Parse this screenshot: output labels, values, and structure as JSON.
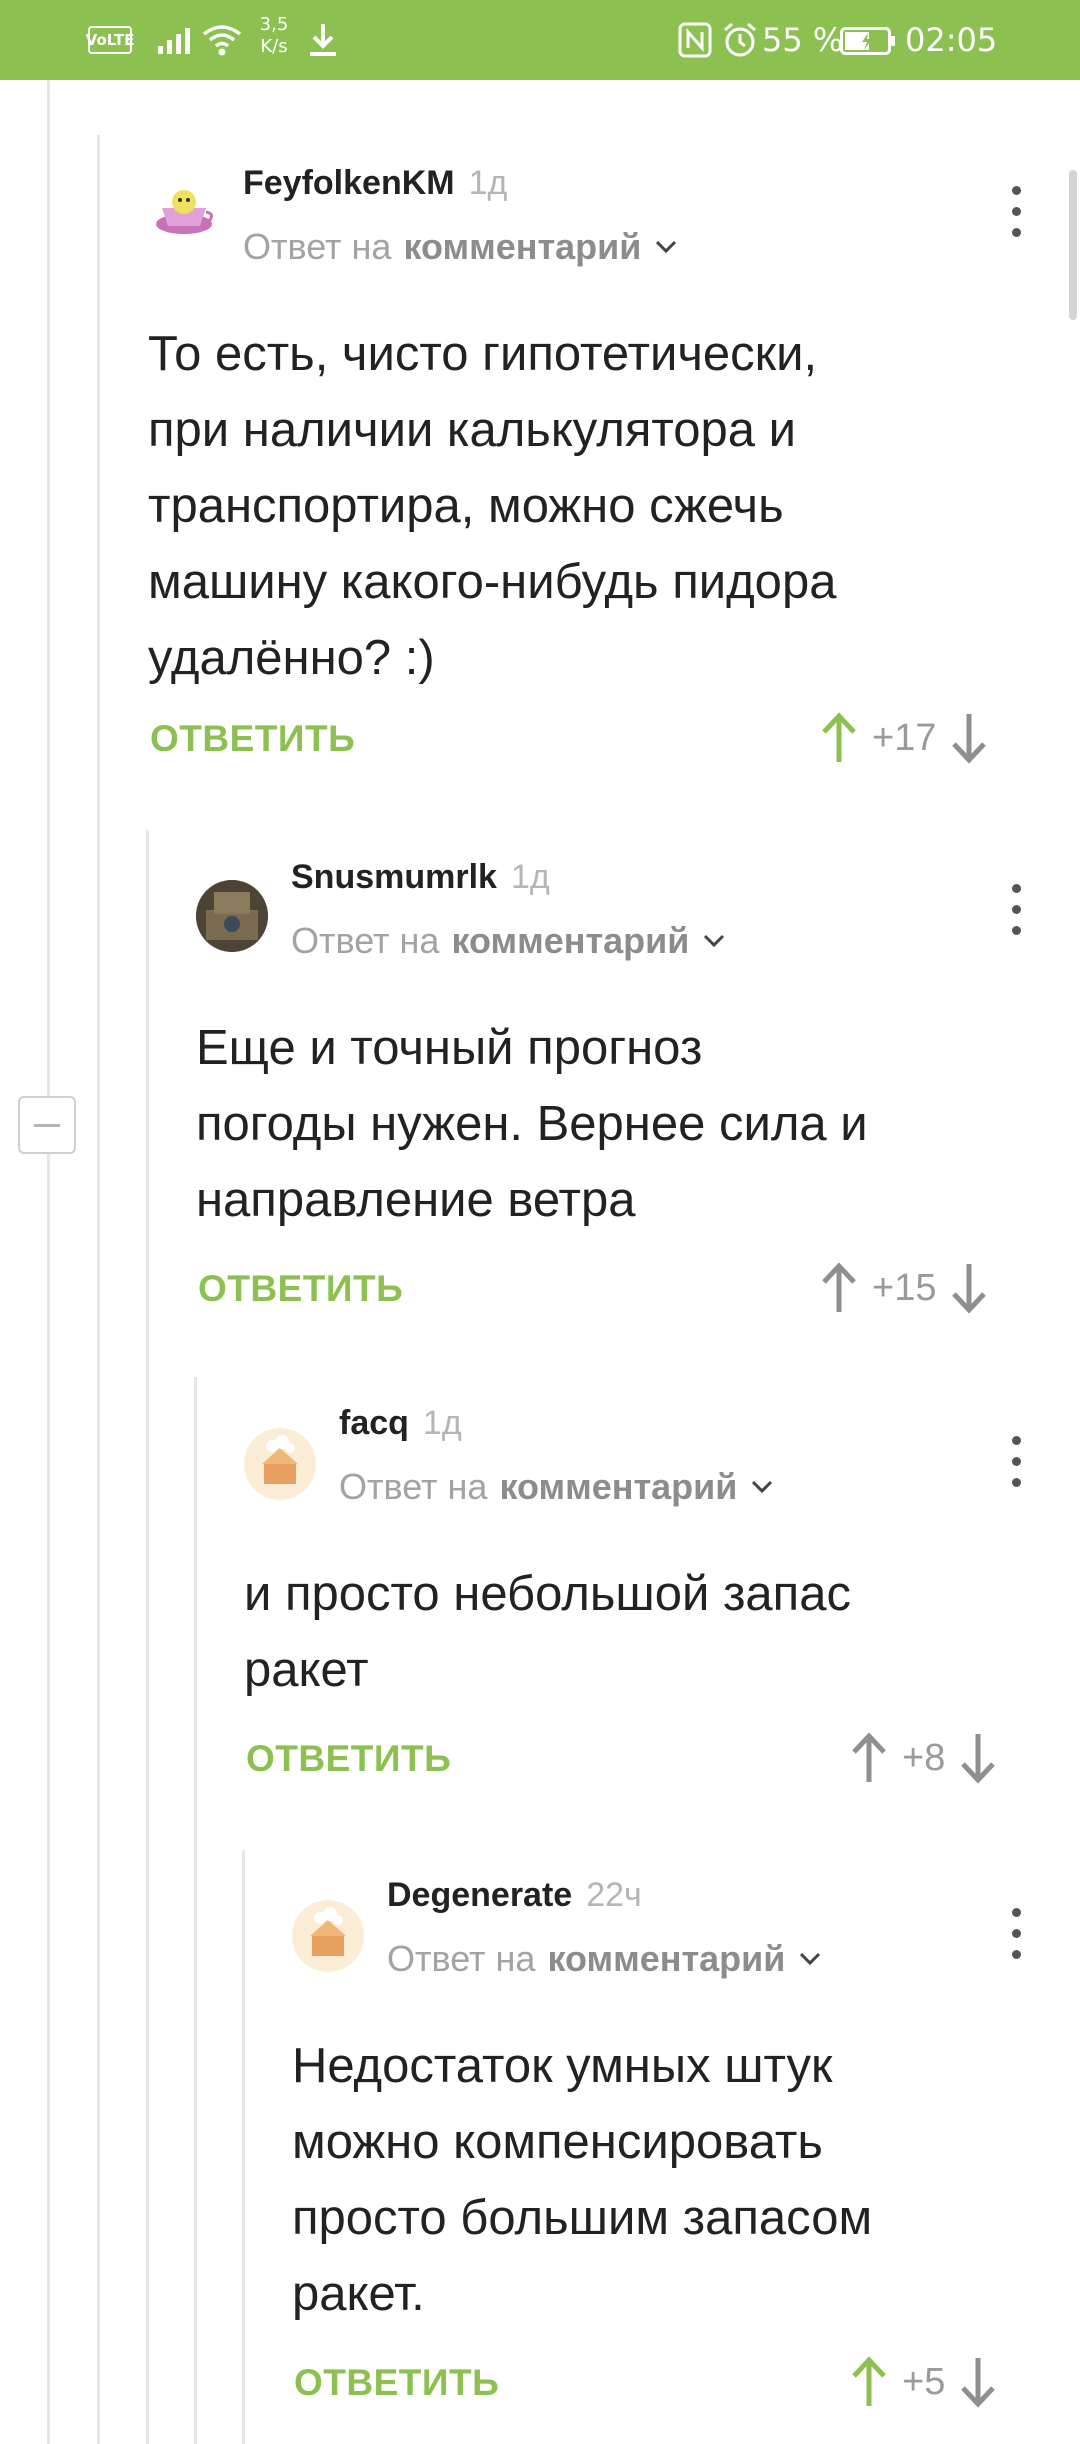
{
  "status_bar": {
    "volte": "VoLTE",
    "speed_value": "3,5",
    "speed_unit": "K/s",
    "battery": "55 %",
    "time": "02:05"
  },
  "reply_to_prefix": "Ответ на",
  "reply_to_link": "комментарий",
  "reply_label": "ОТВЕТИТЬ",
  "colors": {
    "accent": "#8cc152",
    "upvoted": "#8cc152",
    "neutral_arrow": "#8f8f8f"
  },
  "comments": [
    {
      "author": "FeyfolkenKM",
      "time": "1д",
      "text": "То есть, чисто гипотетически,\nпри наличии калькулятора и\nтранспортира, можно сжечь\nмашину какого-нибудь пидора\nудалённо? :)",
      "rating": "+17",
      "upvoted": true
    },
    {
      "author": "Snusmumrlk",
      "time": "1д",
      "text": "Еще и точный прогноз\nпогоды нужен. Вернее сила и\nнаправление ветра",
      "rating": "+15",
      "upvoted": false
    },
    {
      "author": "facq",
      "time": "1д",
      "text": "и просто небольшой запас\nракет",
      "rating": "+8",
      "upvoted": false
    },
    {
      "author": "Degenerate",
      "time": "22ч",
      "text": "Недостаток умных штук\nможно компенсировать\nпросто большим запасом\nракет.",
      "rating": "+5",
      "upvoted": true
    }
  ]
}
